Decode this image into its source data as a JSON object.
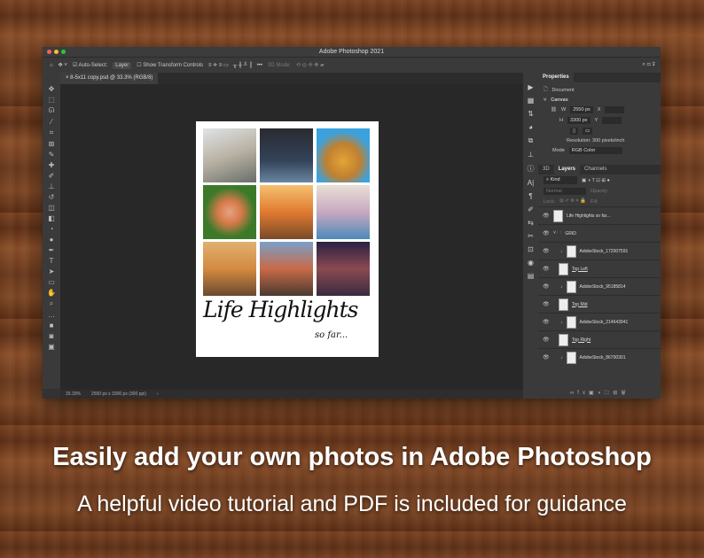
{
  "window": {
    "title": "Adobe Photoshop 2021"
  },
  "options": {
    "auto_select": "Auto-Select:",
    "layer_select": "Layer",
    "show_transform": "Show Transform Controls",
    "mode_3d": "3D Mode:"
  },
  "tab": {
    "label": "8-5x11 copy.psd @ 33.3% (RGB/8)"
  },
  "document": {
    "title_script": "Life Highlights",
    "subtitle_script": "so far..."
  },
  "status": {
    "zoom": "33.33%",
    "size": "2550 px x 3300 px (300 ppi)"
  },
  "properties": {
    "tab": "Properties",
    "type": "Document",
    "section": "Canvas",
    "w_label": "W",
    "w": "2550 px",
    "h_label": "H",
    "h": "3300 px",
    "x_label": "X",
    "y_label": "Y",
    "resolution": "Resolution: 300 pixels/inch",
    "mode_label": "Mode",
    "mode": "RGB Color"
  },
  "layers_panel": {
    "tabs": [
      "3D",
      "Layers",
      "Channels"
    ],
    "filter": "Kind",
    "blend": "Normal",
    "opacity": "Opacity:",
    "lock": "Lock:",
    "fill": "Fill:",
    "layers": [
      {
        "name": "Life Highlights so far..."
      },
      {
        "name": "GRID"
      },
      {
        "name": "AdobeStock_172007591"
      },
      {
        "name": "Top Left"
      },
      {
        "name": "AdobeStock_95185814"
      },
      {
        "name": "Top Mid"
      },
      {
        "name": "AdobeStock_214643941"
      },
      {
        "name": "Top Right"
      },
      {
        "name": "AdobeStock_86700301"
      }
    ]
  },
  "captions": {
    "headline": "Easily add your own photos in Adobe Photoshop",
    "sub": "A helpful video tutorial and PDF is included for guidance"
  }
}
